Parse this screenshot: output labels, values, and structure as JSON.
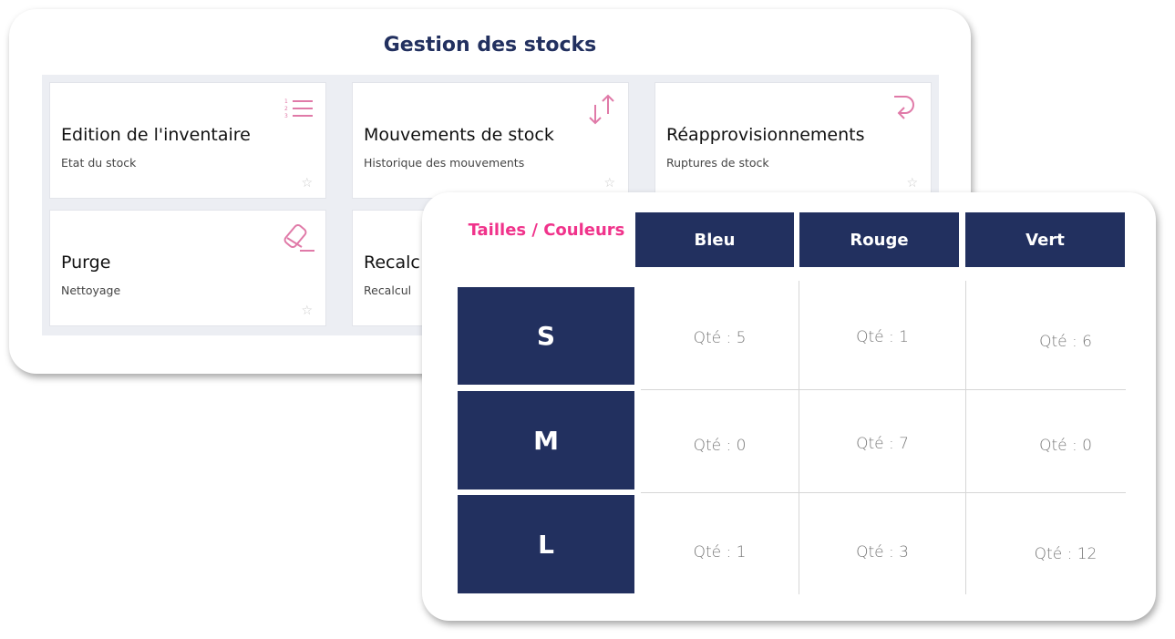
{
  "menu": {
    "title": "Gestion des stocks",
    "cards": [
      {
        "title": "Edition de l'inventaire",
        "subtitle": "Etat du stock",
        "icon": "numbered-list-icon"
      },
      {
        "title": "Mouvements de stock",
        "subtitle": "Historique des mouvements",
        "icon": "swap-vertical-icon"
      },
      {
        "title": "Réapprovisionnements",
        "subtitle": "Ruptures de stock",
        "icon": "return-arrow-icon"
      },
      {
        "title": "Purge",
        "subtitle": "Nettoyage",
        "icon": "eraser-icon"
      },
      {
        "title": "Recalc",
        "subtitle": "Recalcul",
        "icon": ""
      }
    ],
    "favorite_icon": "star-icon"
  },
  "matrix": {
    "corner": "Tailles / Couleurs",
    "columns": [
      "Bleu",
      "Rouge",
      "Vert"
    ],
    "rows": [
      {
        "size": "S",
        "values": [
          "Qté : 5",
          "Qté : 1",
          "Qté : 6"
        ]
      },
      {
        "size": "M",
        "values": [
          "Qté : 0",
          "Qté : 7",
          "Qté : 0"
        ]
      },
      {
        "size": "L",
        "values": [
          "Qté : 1",
          "Qté : 3",
          "Qté : 12"
        ]
      }
    ]
  },
  "colors": {
    "navy": "#22305f",
    "pink": "#f0338b",
    "icon_pink": "#e07aa8"
  }
}
